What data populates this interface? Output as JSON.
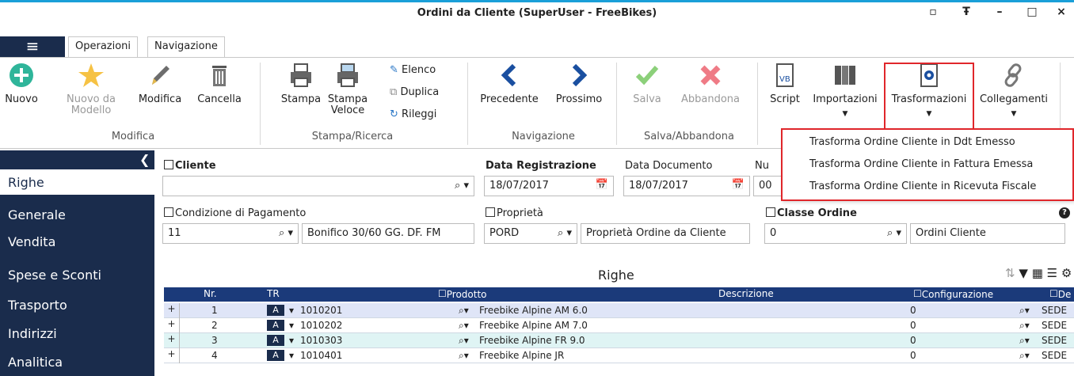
{
  "window": {
    "title": "Ordini da Cliente (SuperUser - FreeBikes)",
    "controls": [
      "▫",
      "Ŧ",
      "–",
      "□",
      "×"
    ]
  },
  "tabs": [
    "Operazioni",
    "Navigazione"
  ],
  "ribbon": {
    "nuovo": "Nuovo",
    "nuovo_modello": "Nuovo da Modello",
    "modifica": "Modifica",
    "cancella": "Cancella",
    "stampa": "Stampa",
    "stampa_veloce": "Stampa Veloce",
    "elenco": "Elenco",
    "duplica": "Duplica",
    "rileggi": "Rileggi",
    "precedente": "Precedente",
    "prossimo": "Prossimo",
    "salva": "Salva",
    "abbandona": "Abbandona",
    "script": "Script",
    "importazioni": "Importazioni",
    "trasformazioni": "Trasformazioni",
    "collegamenti": "Collegamenti",
    "groups": {
      "modifica": "Modifica",
      "stampa_ricerca": "Stampa/Ricerca",
      "navigazione": "Navigazione",
      "salva_abbandona": "Salva/Abbandona"
    }
  },
  "dropdown": [
    "Trasforma Ordine Cliente in Ddt Emesso",
    "Trasforma Ordine Cliente in Fattura Emessa",
    "Trasforma Ordine Cliente in Ricevuta Fiscale"
  ],
  "sidebar": [
    "Righe",
    "Generale",
    "Vendita",
    "Spese e Sconti",
    "Trasporto",
    "Indirizzi",
    "Analitica"
  ],
  "form": {
    "cliente_label": "Cliente",
    "data_registrazione_label": "Data Registrazione",
    "data_registrazione": "18/07/2017",
    "data_documento_label": "Data Documento",
    "data_documento": "18/07/2017",
    "numero_label": "Nu",
    "numero_value": "00",
    "condizione_label": "Condizione di Pagamento",
    "condizione_code": "11",
    "condizione_desc": "Bonifico 30/60 GG. DF. FM",
    "proprieta_label": "Proprietà",
    "proprieta_code": "PORD",
    "proprieta_desc": "Proprietà Ordine da Cliente",
    "classe_label": "Classe Ordine",
    "classe_code": "0",
    "classe_desc": "Ordini Cliente"
  },
  "grid": {
    "title": "Righe",
    "columns": [
      "Nr.",
      "TR",
      "Prodotto",
      "Descrizione",
      "Configurazione",
      "De"
    ],
    "rows": [
      {
        "nr": "1",
        "tr": "A",
        "prodotto": "1010201",
        "descrizione": "Freebike Alpine AM 6.0",
        "config": "0",
        "de": "SEDE"
      },
      {
        "nr": "2",
        "tr": "A",
        "prodotto": "1010202",
        "descrizione": "Freebike Alpine AM 7.0",
        "config": "0",
        "de": "SEDE"
      },
      {
        "nr": "3",
        "tr": "A",
        "prodotto": "1010303",
        "descrizione": "Freebike Alpine FR 9.0",
        "config": "0",
        "de": "SEDE"
      },
      {
        "nr": "4",
        "tr": "A",
        "prodotto": "1010401",
        "descrizione": "Freebike Alpine JR",
        "config": "0",
        "de": "SEDE"
      }
    ]
  }
}
